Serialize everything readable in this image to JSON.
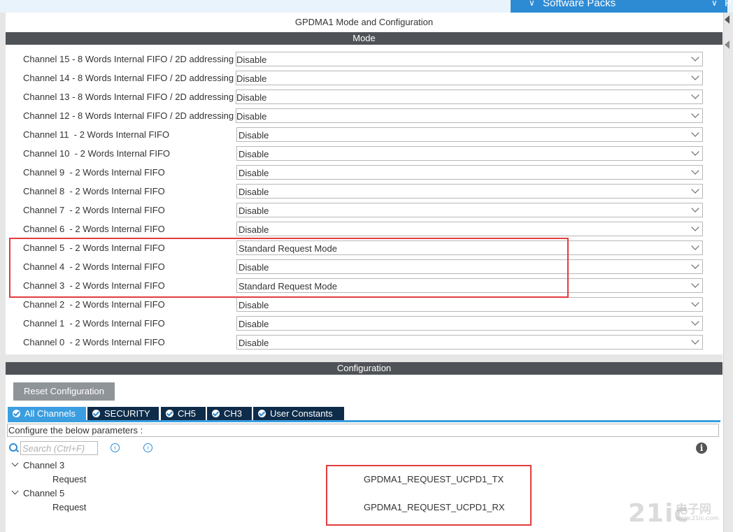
{
  "topbar": {
    "software_packs": "Software Packs",
    "right_partial": "P"
  },
  "panel": {
    "title": "GPDMA1 Mode and Configuration",
    "mode_header": "Mode",
    "config_header": "Configuration"
  },
  "channels": [
    {
      "label": "Channel 15 - 8 Words Internal FIFO / 2D addressing",
      "value": "Disable"
    },
    {
      "label": "Channel 14 - 8 Words Internal FIFO / 2D addressing",
      "value": "Disable"
    },
    {
      "label": "Channel 13 - 8 Words Internal FIFO / 2D addressing",
      "value": "Disable"
    },
    {
      "label": "Channel 12 - 8 Words Internal FIFO / 2D addressing",
      "value": "Disable"
    },
    {
      "label": "Channel 11  - 2 Words Internal FIFO",
      "value": "Disable"
    },
    {
      "label": "Channel 10  - 2 Words Internal FIFO",
      "value": "Disable"
    },
    {
      "label": "Channel 9  - 2 Words Internal FIFO",
      "value": "Disable"
    },
    {
      "label": "Channel 8  - 2 Words Internal FIFO",
      "value": "Disable"
    },
    {
      "label": "Channel 7  - 2 Words Internal FIFO",
      "value": "Disable"
    },
    {
      "label": "Channel 6  - 2 Words Internal FIFO",
      "value": "Disable"
    },
    {
      "label": "Channel 5  - 2 Words Internal FIFO",
      "value": "Standard Request Mode"
    },
    {
      "label": "Channel 4  - 2 Words Internal FIFO",
      "value": "Disable"
    },
    {
      "label": "Channel 3  - 2 Words Internal FIFO",
      "value": "Standard Request Mode"
    },
    {
      "label": "Channel 2  - 2 Words Internal FIFO",
      "value": "Disable"
    },
    {
      "label": "Channel 1  - 2 Words Internal FIFO",
      "value": "Disable"
    },
    {
      "label": "Channel 0  - 2 Words Internal FIFO",
      "value": "Disable"
    }
  ],
  "config": {
    "reset_button": "Reset Configuration",
    "tabs": [
      "All Channels",
      "SECURITY",
      "CH5",
      "CH3",
      "User Constants"
    ],
    "instruction": "Configure the below parameters :",
    "search_placeholder": "Search (Ctrl+F)",
    "tree": [
      {
        "group": "Channel 3",
        "param": "Request",
        "value": "GPDMA1_REQUEST_UCPD1_TX"
      },
      {
        "group": "Channel 5",
        "param": "Request",
        "value": "GPDMA1_REQUEST_UCPD1_RX"
      }
    ]
  },
  "watermark": {
    "main": "21ic",
    "sub": "电子网",
    "url": "www.21ic.com"
  },
  "colors": {
    "accent": "#2d8bd4",
    "header_bar": "#4f5357",
    "tab_dark": "#0e2c4a",
    "highlight_box": "#e23c3c"
  }
}
